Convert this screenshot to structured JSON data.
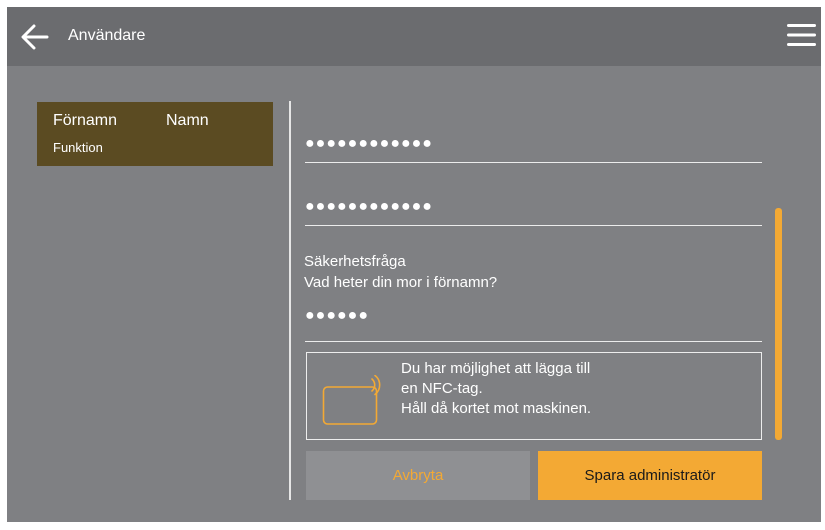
{
  "header": {
    "back_icon": "arrow-left-icon",
    "title": "Användare",
    "menu_icon": "hamburger-menu-icon"
  },
  "user_card": {
    "first_name": "Förnamn",
    "last_name": "Namn",
    "function": "Funktion"
  },
  "form": {
    "password": "●●●●●●●●●●●●",
    "password_confirm": "●●●●●●●●●●●●",
    "security_question_label": "Säkerhetsfråga",
    "security_question": "Vad heter din mor i förnamn?",
    "security_answer": "●●●●●●"
  },
  "nfc": {
    "icon": "nfc-card-icon",
    "lines": [
      "Du har möjlighet att lägga till",
      "en NFC-tag.",
      "Håll då kortet mot maskinen."
    ]
  },
  "actions": {
    "cancel_label": "Avbryta",
    "save_label": "Spara administratör"
  },
  "colors": {
    "accent": "#f3a934",
    "background": "#7f8083",
    "header": "#6b6c6f",
    "user_card": "#5b4b22"
  }
}
